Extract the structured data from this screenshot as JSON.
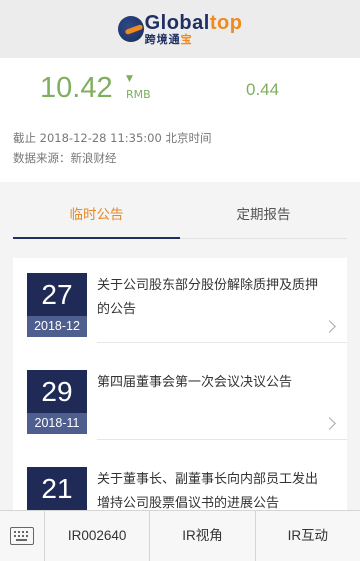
{
  "brand": {
    "logo_word_a": "Global",
    "logo_word_b": "top",
    "logo_cn_a": "跨境通",
    "logo_cn_b": "宝",
    "colors": {
      "navy": "#1f2f63",
      "orange": "#f08a1c"
    }
  },
  "quote": {
    "price": "10.42",
    "direction_icon": "triangle-down-icon",
    "arrow": "▼",
    "currency": "RMB",
    "change": "0.44",
    "as_of": "截止 2018-12-28  11:35:00 北京时间",
    "source": "数据来源：新浪财经",
    "color": "#7fae5e"
  },
  "tabs": [
    {
      "label": "临时公告",
      "active": true
    },
    {
      "label": "定期报告",
      "active": false
    }
  ],
  "announcements": [
    {
      "day": "27",
      "year_month": "2018-12",
      "title": "关于公司股东部分股份解除质押及质押的公告"
    },
    {
      "day": "29",
      "year_month": "2018-11",
      "title": "第四届董事会第一次会议决议公告"
    },
    {
      "day": "21",
      "year_month": "",
      "title": "关于董事长、副董事长向内部员工发出增持公司股票倡议书的进展公告"
    }
  ],
  "bottom_nav": {
    "keyboard_icon": "keyboard-icon",
    "items": [
      {
        "label": "IR002640"
      },
      {
        "label": "IR视角"
      },
      {
        "label": "IR互动"
      }
    ]
  }
}
